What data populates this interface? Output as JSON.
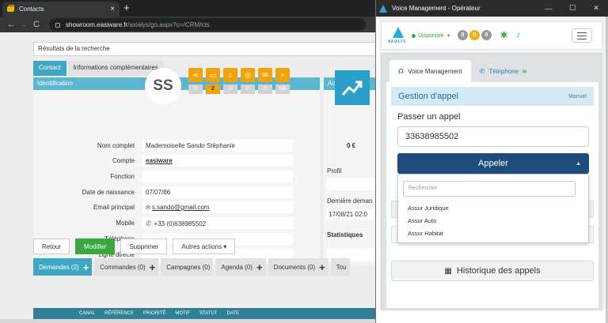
{
  "browser": {
    "tab_title": "Contacts",
    "tab_close": "×",
    "new_tab": "+",
    "back": "←",
    "forward": "→",
    "reload": "C",
    "url_host": "showroom.easiware.fr",
    "url_path": "/axialys/go.aspx?u=/CRM/cts"
  },
  "crm": {
    "search_title": "Résultats de la recherche",
    "tabs": [
      "Contact",
      "Informations complémentaires"
    ],
    "identification_title": "Identification",
    "activity_title": "Activité client",
    "avatar_initials": "SS",
    "badges": [
      {
        "icon": "share-icon",
        "glyph": "⋖",
        "count": "0"
      },
      {
        "icon": "inbox-icon",
        "glyph": "▭",
        "count": "2"
      },
      {
        "icon": "basket-icon",
        "glyph": "⌂",
        "count": "0"
      },
      {
        "icon": "target-icon",
        "glyph": "◎",
        "count": "0"
      },
      {
        "icon": "chat-icon",
        "glyph": "✉",
        "count": "0"
      },
      {
        "icon": "rating-icon",
        "glyph": "≈",
        "count": "NA"
      }
    ],
    "fields": [
      {
        "label": "Nom complet",
        "value": "Mademoiselle Sando Stéphanie"
      },
      {
        "label": "Compte",
        "value": "easiware"
      },
      {
        "label": "Fonction",
        "value": ""
      },
      {
        "label": "Date de naissance",
        "value": "07/07/86"
      },
      {
        "label": "Email principal",
        "value": "s.sando@gmail.com"
      },
      {
        "label": "Mobile",
        "value": "+33 (0)638985502"
      },
      {
        "label": "Téléphone",
        "value": ""
      },
      {
        "label": "Ligne directe",
        "value": ""
      }
    ],
    "activity_amount": "0 €",
    "profil_label": "Profil",
    "derniere_label": "Dernière deman",
    "derniere_value": "17/08/21 02:0",
    "stats_label": "Statistiques",
    "actions": {
      "retour": "Retour",
      "modifier": "Modifier",
      "supprimer": "Supprimer",
      "autres": "Autres actions ▾"
    },
    "subtabs": [
      {
        "label": "Demandes (2)",
        "plus": "+"
      },
      {
        "label": "Commandes (0)",
        "plus": "+"
      },
      {
        "label": "Campagnes (0)",
        "plus": ""
      },
      {
        "label": "Agenda (0)",
        "plus": "+"
      },
      {
        "label": "Documents (0)",
        "plus": "+"
      },
      {
        "label": "Tou",
        "plus": ""
      }
    ],
    "table_columns": [
      "CANAL",
      "RÉFÉRENCE",
      "PRIORITÉ",
      "MOTIF",
      "STATUT",
      "DATE"
    ]
  },
  "vm": {
    "window_title": "Voice Management - Opérateur",
    "logo_word": "AXIALYS",
    "status": "Disponible",
    "counters": [
      {
        "value": "0",
        "color": "#9a9a9a"
      },
      {
        "value": "0",
        "color": "#f2b10d"
      },
      {
        "value": "0",
        "color": "#9a9a9a"
      }
    ],
    "tabs": [
      "Voice Management",
      "Téléphone"
    ],
    "gestion_title": "Gestion d'appel",
    "gestion_mode": "Manuel",
    "passer_label": "Passer un appel",
    "number_value": "33638985502",
    "appeler_label": "Appeler",
    "search_placeholder": "Rechercher",
    "menu_items": [
      "Assur Juridique",
      "Assur Auto",
      "Assur Habitat"
    ],
    "historique_label": "Historique des appels"
  },
  "colors": {
    "accent": "#3fa7c4",
    "badge": "#f0a30a",
    "primary_button": "#3aa83d",
    "call_button": "#1f4c7c"
  }
}
